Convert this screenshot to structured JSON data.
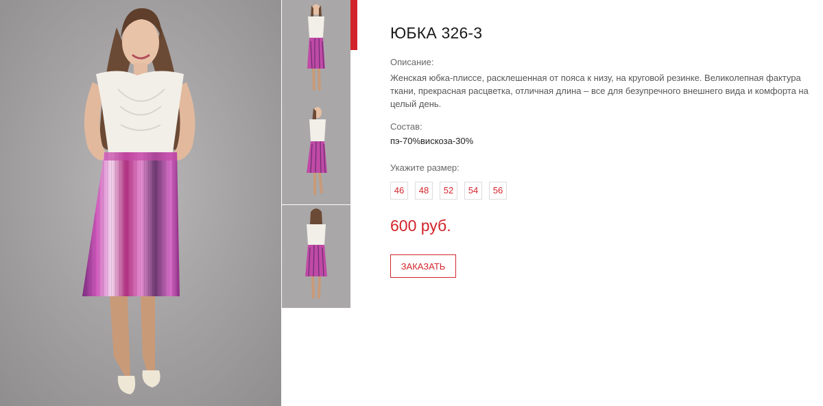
{
  "colors": {
    "accent": "#d2232a",
    "text": "#333333",
    "muted": "#666666",
    "border": "#dcdcdc",
    "photo_background": "#a7a5a6"
  },
  "gallery": {
    "main_image": "model-full-length-photo",
    "thumbnails": [
      {
        "image": "model-front-view-photo",
        "active": true
      },
      {
        "image": "model-side-view-photo",
        "active": false
      },
      {
        "image": "model-back-view-photo",
        "active": false
      }
    ]
  },
  "product": {
    "title": "ЮБКА 326-3",
    "description_label": "Описание:",
    "description": "Женская юбка-плиссе, расклешенная от пояса к низу, на круговой резинке. Великолепная фактура ткани, прекрасная расцветка, отличная длина – все для безупречного внешнего вида и комфорта на целый день.",
    "composition_label": "Состав:",
    "composition": "пэ-70%вискоза-30%",
    "size_label": "Укажите размер:",
    "sizes": [
      "46",
      "48",
      "52",
      "54",
      "56"
    ],
    "price": "600 руб.",
    "order_button": "ЗАКАЗАТЬ"
  }
}
